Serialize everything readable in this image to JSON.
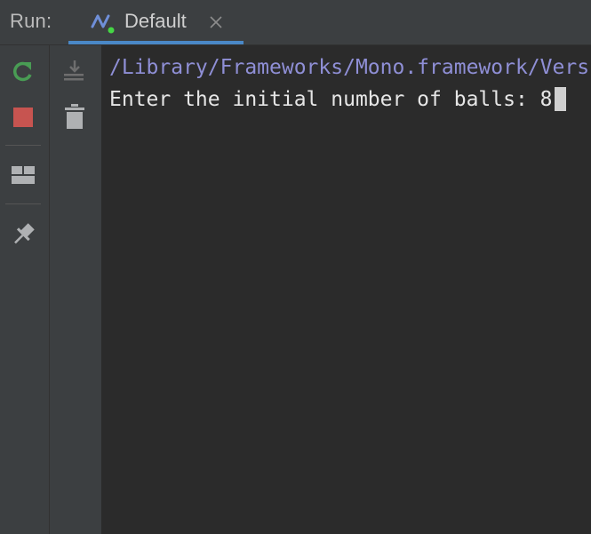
{
  "header": {
    "run_label": "Run:",
    "tab": {
      "label": "Default",
      "icon": "dotnet-config-icon",
      "status": "running"
    }
  },
  "toolbar": {
    "left": [
      {
        "name": "rerun-icon",
        "color": "#499c54"
      },
      {
        "name": "stop-icon",
        "color": "#c75450"
      },
      {
        "name": "layout-icon"
      },
      {
        "name": "pin-icon"
      }
    ],
    "right": [
      {
        "name": "scroll-to-end-icon"
      },
      {
        "name": "clear-all-icon"
      }
    ]
  },
  "console": {
    "path_line": "/Library/Frameworks/Mono.framework/Versions/Current/bin/mono",
    "prompt": "Enter the initial number of balls: ",
    "input": "8"
  },
  "colors": {
    "accent": "#4a88c7",
    "path_text": "#8f8fd6",
    "console_text": "#e6e6e6",
    "background": "#2b2b2b",
    "panel": "#3c3f41"
  }
}
